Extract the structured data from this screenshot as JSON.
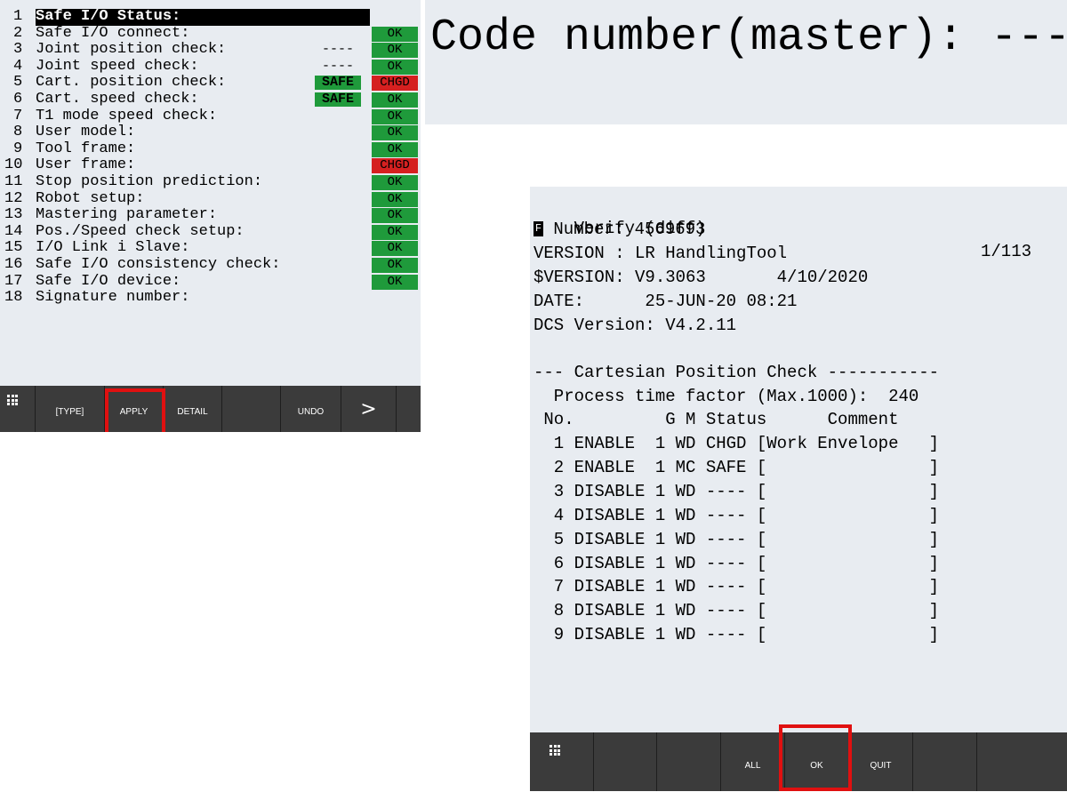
{
  "left": {
    "rows": [
      {
        "num": "1",
        "label": "Safe I/O Status:",
        "mid": "",
        "status": "",
        "selected": true
      },
      {
        "num": "2",
        "label": "Safe I/O connect:",
        "mid": "",
        "status": "OK"
      },
      {
        "num": "3",
        "label": "Joint position check:",
        "mid": "----",
        "status": "OK"
      },
      {
        "num": "4",
        "label": "Joint speed check:",
        "mid": "----",
        "status": "OK"
      },
      {
        "num": "5",
        "label": "Cart. position check:",
        "mid": "SAFE",
        "status": "CHGD"
      },
      {
        "num": "6",
        "label": "Cart. speed check:",
        "mid": "SAFE",
        "status": "OK"
      },
      {
        "num": "7",
        "label": "T1 mode speed check:",
        "mid": "",
        "status": "OK"
      },
      {
        "num": "8",
        "label": "User model:",
        "mid": "",
        "status": "OK"
      },
      {
        "num": "9",
        "label": "Tool frame:",
        "mid": "",
        "status": "OK"
      },
      {
        "num": "10",
        "label": "User frame:",
        "mid": "",
        "status": "CHGD"
      },
      {
        "num": "11",
        "label": "Stop position prediction:",
        "mid": "",
        "status": "OK"
      },
      {
        "num": "12",
        "label": "Robot setup:",
        "mid": "",
        "status": "OK"
      },
      {
        "num": "13",
        "label": "Mastering parameter:",
        "mid": "",
        "status": "OK"
      },
      {
        "num": "14",
        "label": "Pos./Speed check setup:",
        "mid": "",
        "status": "OK"
      },
      {
        "num": "15",
        "label": "I/O Link i Slave:",
        "mid": "",
        "status": "OK"
      },
      {
        "num": "16",
        "label": "Safe I/O consistency check:",
        "mid": "",
        "status": "OK"
      },
      {
        "num": "17",
        "label": "Safe I/O device:",
        "mid": "",
        "status": "OK"
      },
      {
        "num": "18",
        "label": "Signature number:",
        "mid": "",
        "status": ""
      }
    ],
    "softkeys": [
      "",
      "[TYPE]",
      "APPLY",
      "DETAIL",
      "",
      "UNDO",
      ">"
    ],
    "highlighted_softkey": "APPLY"
  },
  "code_banner": "Code number(master): ----",
  "verify": {
    "title": "Verify (diff)",
    "page": "1/113",
    "f_label": "F",
    "number_line": " Number: 4569693",
    "version_line": "VERSION : LR HandlingTool",
    "sversion_line": "$VERSION: V9.3063       4/10/2020",
    "date_line": "DATE:      25-JUN-20 08:21",
    "dcs_line": "DCS Version: V4.2.11",
    "section_line": "--- Cartesian Position Check -----------",
    "factor_line": "  Process time factor (Max.1000):  240",
    "header_line": " No.         G M Status      Comment",
    "rows": [
      "  1 ENABLE  1 WD CHGD [Work Envelope   ]",
      "  2 ENABLE  1 MC SAFE [                ]",
      "  3 DISABLE 1 WD ---- [                ]",
      "  4 DISABLE 1 WD ---- [                ]",
      "  5 DISABLE 1 WD ---- [                ]",
      "  6 DISABLE 1 WD ---- [                ]",
      "  7 DISABLE 1 WD ---- [                ]",
      "  8 DISABLE 1 WD ---- [                ]",
      "  9 DISABLE 1 WD ---- [                ]"
    ],
    "softkeys": [
      "",
      "",
      "",
      "ALL",
      "OK",
      "QUIT",
      ""
    ],
    "highlighted_softkey": "OK"
  },
  "colors": {
    "ok": "#1f9a3b",
    "chgd": "#d52020",
    "highlight_box": "#e01010",
    "softbar": "#3b3b3b"
  }
}
